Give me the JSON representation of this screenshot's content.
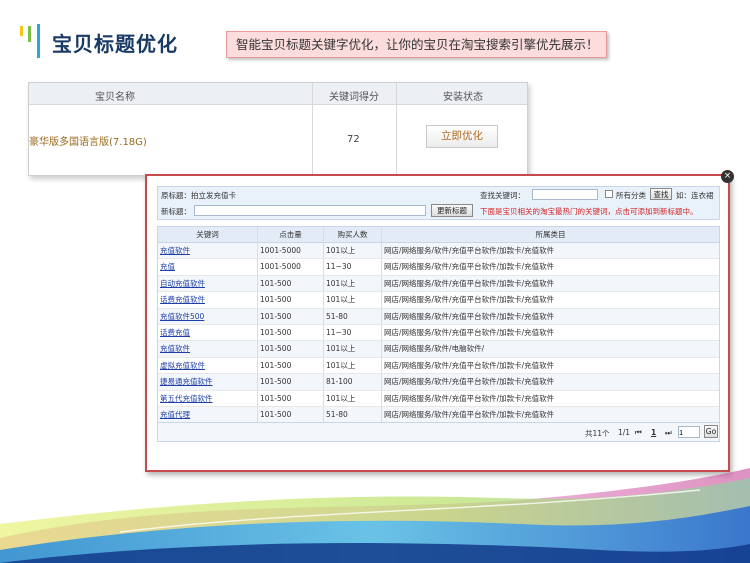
{
  "header": {
    "title": "宝贝标题优化",
    "callout": "智能宝贝标题关键字优化，让你的宝贝在淘宝搜索引擎优先展示！",
    "bar_colors": [
      "#f5c518",
      "#7ac143",
      "#2aa7e0"
    ]
  },
  "back_table": {
    "columns": [
      "宝贝名称",
      "关键词得分",
      "安装状态"
    ],
    "row": {
      "product": "豪华版多国语言版(7.18G)",
      "score": "72",
      "action": "立即优化"
    }
  },
  "dialog": {
    "close": "×",
    "original_title_label": "原标题：拍立发充值卡",
    "find_keyword_label": "查找关键词：",
    "all_categories_label": "所有分类",
    "search_button": "查找",
    "example_hint": "如：连衣裙",
    "new_title_label": "新标题：",
    "update_title_button": "更新标题",
    "note": "下面是宝贝相关的淘宝最热门的关键词，点击可添加到新标题中。",
    "columns": [
      "关键词",
      "点击量",
      "购买人数",
      "所属类目"
    ],
    "rows": [
      {
        "keyword": "充值软件",
        "clicks": "1001-5000",
        "buyers": "101以上",
        "category": "网店/网络服务/软件/充值平台软件/加款卡/充值软件"
      },
      {
        "keyword": "充值",
        "clicks": "1001-5000",
        "buyers": "11~30",
        "category": "网店/网络服务/软件/充值平台软件/加款卡/充值软件"
      },
      {
        "keyword": "自动充值软件",
        "clicks": "101-500",
        "buyers": "101以上",
        "category": "网店/网络服务/软件/充值平台软件/加款卡/充值软件"
      },
      {
        "keyword": "话费充值软件",
        "clicks": "101-500",
        "buyers": "101以上",
        "category": "网店/网络服务/软件/充值平台软件/加款卡/充值软件"
      },
      {
        "keyword": "充值软件500",
        "clicks": "101-500",
        "buyers": "51-80",
        "category": "网店/网络服务/软件/充值平台软件/加款卡/充值软件"
      },
      {
        "keyword": "话费充值",
        "clicks": "101-500",
        "buyers": "11~30",
        "category": "网店/网络服务/软件/充值平台软件/加款卡/充值软件"
      },
      {
        "keyword": "充值软件",
        "clicks": "101-500",
        "buyers": "101以上",
        "category": "网店/网络服务/软件/电脑软件/"
      },
      {
        "keyword": "虚拟充值软件",
        "clicks": "101-500",
        "buyers": "101以上",
        "category": "网店/网络服务/软件/充值平台软件/加款卡/充值软件"
      },
      {
        "keyword": "捷易通充值软件",
        "clicks": "101-500",
        "buyers": "81-100",
        "category": "网店/网络服务/软件/充值平台软件/加款卡/充值软件"
      },
      {
        "keyword": "第五代充值软件",
        "clicks": "101-500",
        "buyers": "101以上",
        "category": "网店/网络服务/软件/充值平台软件/加款卡/充值软件"
      },
      {
        "keyword": "充值代理",
        "clicks": "101-500",
        "buyers": "51-80",
        "category": "网店/网络服务/软件/充值平台软件/加款卡/充值软件"
      }
    ],
    "pager": {
      "total": "共11个",
      "pages": "1/1",
      "first": "⏮",
      "current": "1",
      "last": "⏭",
      "goto_value": "1",
      "go": "Go"
    }
  }
}
